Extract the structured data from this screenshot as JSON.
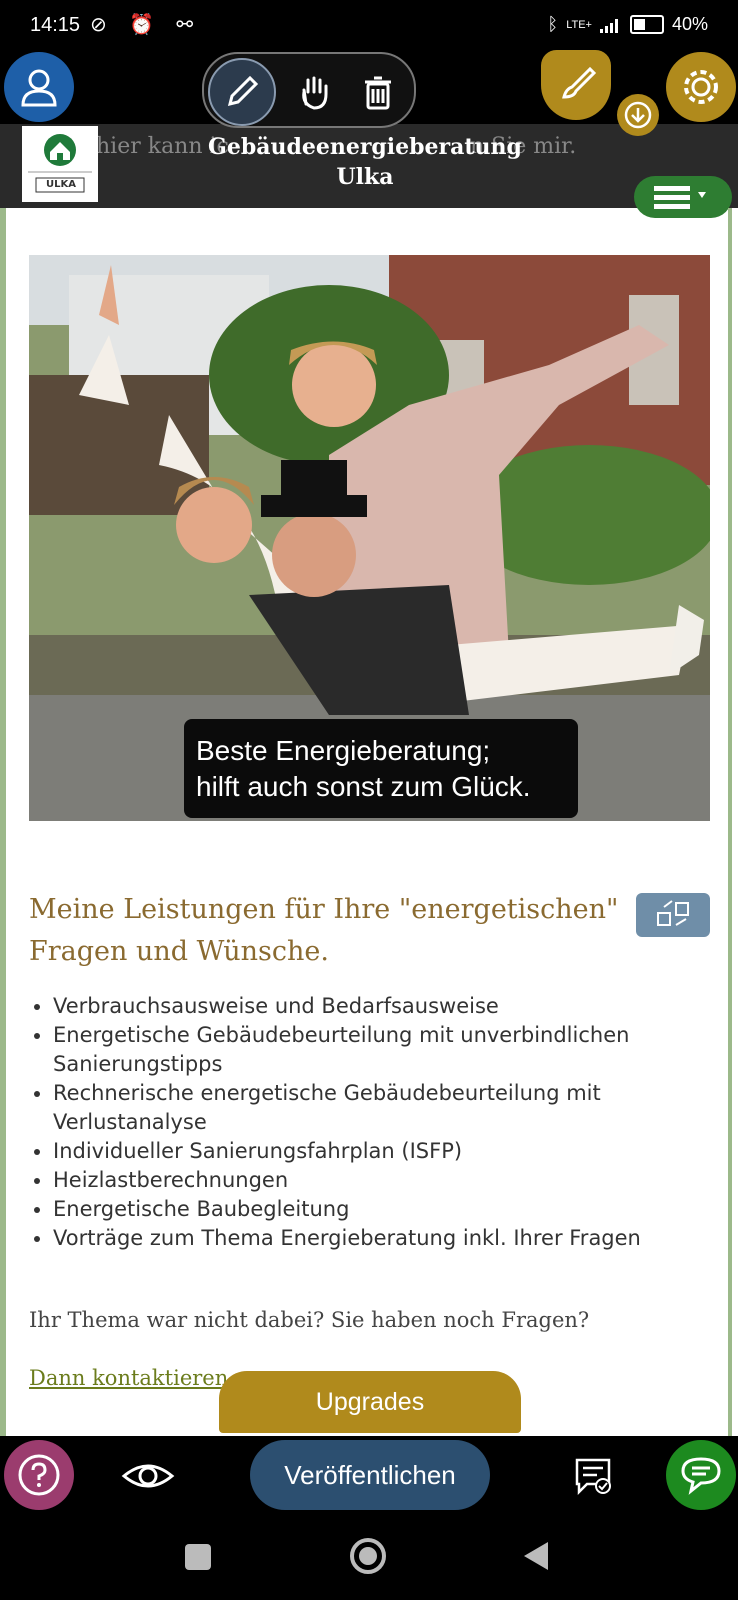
{
  "status_bar": {
    "time": "14:15",
    "left_icons": "⊘ ⏰ ⚯",
    "network": "LTE+",
    "battery": "40%"
  },
  "editor_toolbar": {
    "icons": [
      "profile-icon",
      "pencil-icon",
      "hand-icon",
      "trash-icon",
      "brush-icon",
      "download-icon",
      "gear-icon"
    ]
  },
  "site": {
    "title_line1": "Gebäudeenergieberatung",
    "title_line2": "Ulka",
    "logo_text": "ULKA",
    "underlay_text": "hier kann ic",
    "underlay_text2": "n Sie mir."
  },
  "hero": {
    "caption_line1": "Beste Energieberatung;",
    "caption_line2": "hilft auch sonst zum Glück."
  },
  "services": {
    "title": "Meine Leistungen für Ihre \"energetischen\" Fragen und Wünsche.",
    "items": [
      "Verbrauchsausweise und Bedarfsausweise",
      "Energetische Gebäudebeurteilung mit unverbindlichen Sanierungstipps",
      "Rechnerische energetische Gebäudebeurteilung mit Verlustanalyse",
      "Individueller Sanierungsfahrplan (ISFP)",
      "Heizlastberechnungen",
      "Energetische Baubegleitung",
      "Vorträge zum Thema Energieberatung inkl. Ihrer Fragen"
    ]
  },
  "contact": {
    "question": "Ihr Thema war nicht dabei? Sie haben noch Fragen?",
    "link": "Dann kontaktieren"
  },
  "bottom_bar": {
    "upgrades": "Upgrades",
    "publish": "Veröffentlichen"
  },
  "colors": {
    "accent_gold": "#b08a1c",
    "profile_blue": "#1e5fa8",
    "help_purple": "#9b3c6e",
    "chat_green": "#1d8a1f",
    "publish_blue": "#2c4f70",
    "menu_green": "#2e7d32",
    "title_brown": "#8a6a30"
  }
}
